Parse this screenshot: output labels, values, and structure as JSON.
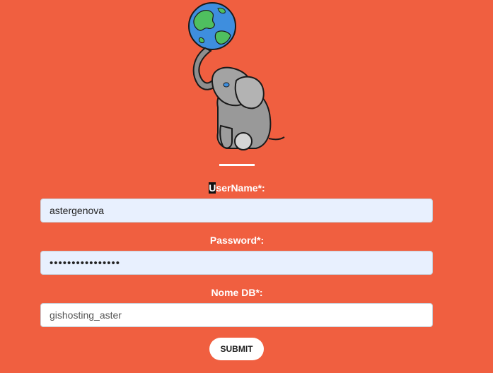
{
  "logo": {
    "icon": "elephant-globe-logo"
  },
  "form": {
    "username": {
      "label_first": "U",
      "label_rest": "serName*:",
      "value": "astergenova"
    },
    "password": {
      "label": "Password*:",
      "value": "••••••••••••••••"
    },
    "dbname": {
      "label": "Nome DB*:",
      "value": "gishosting_aster"
    },
    "submit_label": "SUBMIT"
  },
  "colors": {
    "background": "#f05f40",
    "autofill_field": "#e8f0fe",
    "text_white": "#ffffff"
  }
}
